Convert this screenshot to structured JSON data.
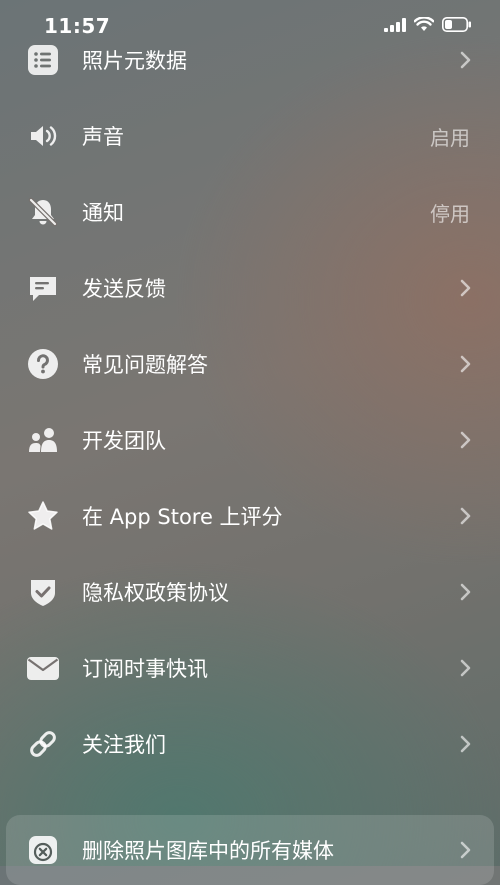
{
  "status": {
    "time": "11:57"
  },
  "menu": {
    "items": [
      {
        "id": "metadata",
        "label": "照片元数据",
        "icon": "list-icon",
        "value": "",
        "chevron": true
      },
      {
        "id": "sound",
        "label": "声音",
        "icon": "speaker-icon",
        "value": "启用",
        "chevron": false
      },
      {
        "id": "notifications",
        "label": "通知",
        "icon": "bell-slash-icon",
        "value": "停用",
        "chevron": false
      },
      {
        "id": "feedback",
        "label": "发送反馈",
        "icon": "message-icon",
        "value": "",
        "chevron": true
      },
      {
        "id": "faq",
        "label": "常见问题解答",
        "icon": "question-icon",
        "value": "",
        "chevron": true
      },
      {
        "id": "team",
        "label": "开发团队",
        "icon": "people-icon",
        "value": "",
        "chevron": true
      },
      {
        "id": "rate",
        "label": "在 App Store 上评分",
        "icon": "star-icon",
        "value": "",
        "chevron": true
      },
      {
        "id": "privacy",
        "label": "隐私权政策协议",
        "icon": "shield-check-icon",
        "value": "",
        "chevron": true
      },
      {
        "id": "newsletter",
        "label": "订阅时事快讯",
        "icon": "envelope-icon",
        "value": "",
        "chevron": true
      },
      {
        "id": "follow",
        "label": "关注我们",
        "icon": "link-icon",
        "value": "",
        "chevron": true
      },
      {
        "id": "delete-all",
        "label": "删除照片图库中的所有媒体",
        "icon": "delete-icon",
        "value": "",
        "chevron": true
      }
    ]
  }
}
